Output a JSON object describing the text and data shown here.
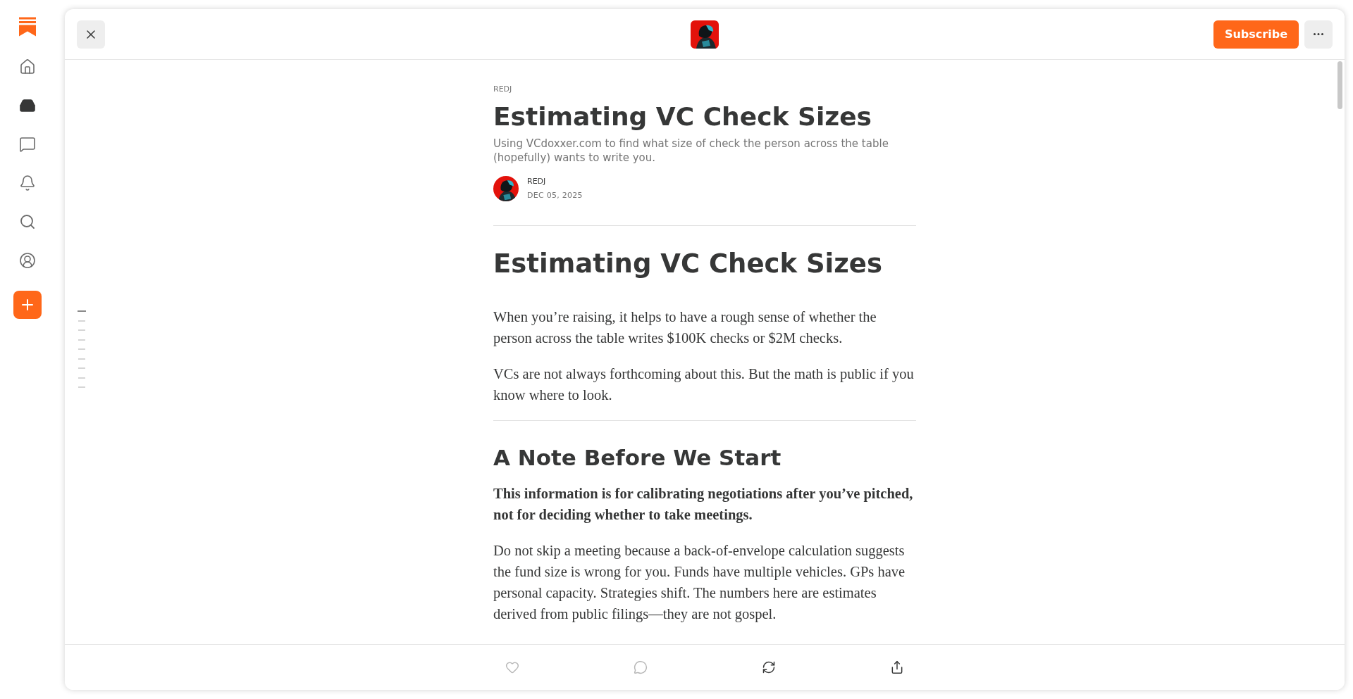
{
  "sidebar": {
    "items": [
      {
        "kind": "logo",
        "selected": false
      },
      {
        "kind": "home",
        "selected": false
      },
      {
        "kind": "inbox",
        "selected": true
      },
      {
        "kind": "chat",
        "selected": false
      },
      {
        "kind": "bell",
        "selected": false
      },
      {
        "kind": "search",
        "selected": false
      },
      {
        "kind": "profile",
        "selected": false
      },
      {
        "kind": "create",
        "selected": false
      }
    ]
  },
  "header": {
    "subscribe": "Subscribe"
  },
  "toc": [
    {
      "selected": true
    },
    {
      "selected": false
    },
    {
      "selected": false
    },
    {
      "selected": false
    },
    {
      "selected": false
    },
    {
      "selected": false
    },
    {
      "selected": false
    },
    {
      "selected": false
    },
    {
      "selected": false
    }
  ],
  "article": {
    "publication": "REDJ",
    "title": "Estimating VC Check Sizes",
    "subtitle": "Using VCdoxxer.com to find what size of check the person across the table (hopefully) wants to write you.",
    "author": "REDJ",
    "date": "DEC 05, 2025",
    "blocks": [
      {
        "kind": "rule"
      },
      {
        "kind": "h1",
        "text": "Estimating VC Check Sizes"
      },
      {
        "kind": "p",
        "text": "When you’re raising, it helps to have a rough sense of whether the person across the table writes $100K checks or $2M checks."
      },
      {
        "kind": "p",
        "text": "VCs are not always forthcoming about this. But the math is public if you know where to look."
      },
      {
        "kind": "rule"
      },
      {
        "kind": "h2",
        "text": "A Note Before We Start"
      },
      {
        "kind": "strong",
        "text": "This information is for calibrating negotiations after you’ve pitched, not for deciding whether to take meetings."
      },
      {
        "kind": "p",
        "text": "Do not skip a meeting because a back-of-envelope calculation suggests the fund size is wrong for you. Funds have multiple vehicles. GPs have personal capacity. Strategies shift. The numbers here are estimates derived from public filings—they are not gospel."
      }
    ]
  },
  "actions": [
    {
      "kind": "like",
      "disabled": true
    },
    {
      "kind": "comment",
      "disabled": true
    },
    {
      "kind": "restack",
      "disabled": false
    },
    {
      "kind": "share",
      "disabled": false
    }
  ]
}
